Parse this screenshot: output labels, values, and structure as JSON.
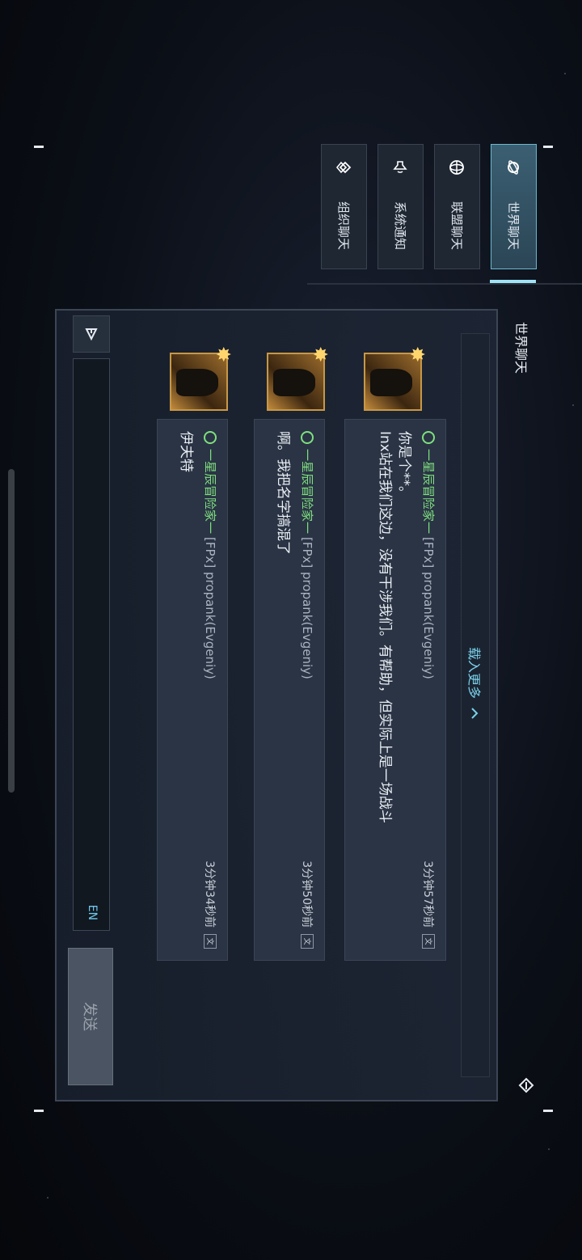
{
  "tabs": [
    {
      "label": "世界聊天",
      "icon": "planet-icon",
      "active": true
    },
    {
      "label": "联盟聊天",
      "icon": "globe-icon"
    },
    {
      "label": "系统通知",
      "icon": "speaker-icon"
    },
    {
      "label": "组织聊天",
      "icon": "org-icon"
    }
  ],
  "header": {
    "title": "世界聊天",
    "exit_icon": "exit-icon"
  },
  "load_more": {
    "label": "载入更多",
    "icon": "chevron-up-icon"
  },
  "messages": [
    {
      "guild": "一星辰冒险家一",
      "user": "[FPx] propank(Evgeniy)",
      "time": "3分钟57秒前",
      "text": "你是个**。\nInx站在我们这边，没有干涉我们。有帮助，但实际上是一场战斗"
    },
    {
      "guild": "一星辰冒险家一",
      "user": "[FPx] propank(Evgeniy)",
      "time": "3分钟50秒前",
      "text": "啊。我把名字搞混了"
    },
    {
      "guild": "一星辰冒险家一",
      "user": "[FPx] propank(Evgeniy)",
      "time": "3分钟34秒前",
      "text": "伊夫特"
    }
  ],
  "input": {
    "placeholder": "",
    "lang": "EN"
  },
  "send_label": "发送"
}
